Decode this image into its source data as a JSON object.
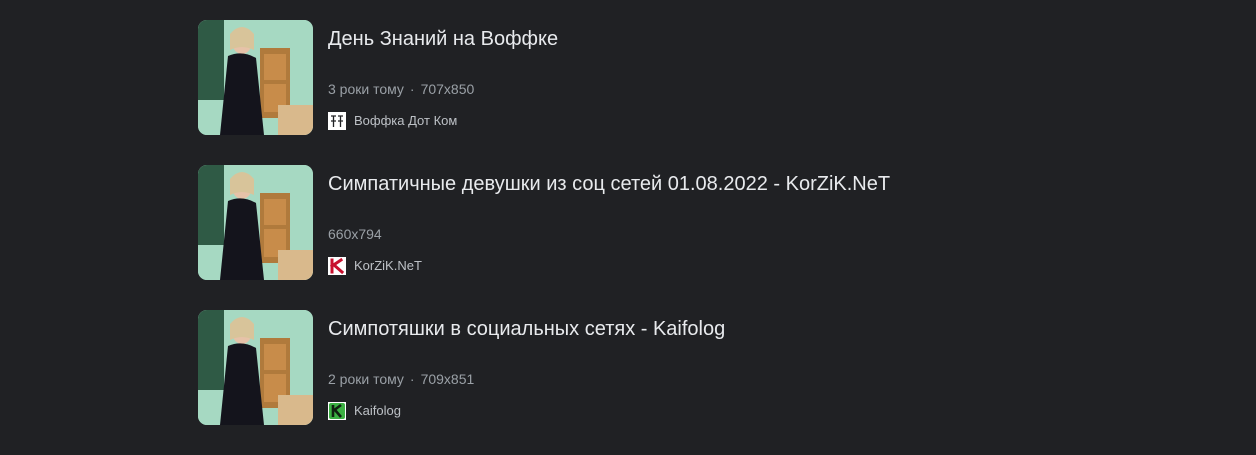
{
  "results": [
    {
      "title": "День Знаний на Воффке",
      "age": "3 роки тому",
      "separator": "·",
      "dimensions": "707x850",
      "source": "Воффка Дот Ком",
      "favicon": "voffka-favicon"
    },
    {
      "title": "Симпатичные девушки из соц сетей 01.08.2022 - KorZiK.NeT",
      "age": "",
      "separator": "",
      "dimensions": "660x794",
      "source": "KorZiK.NeT",
      "favicon": "korzik-favicon"
    },
    {
      "title": "Симпотяшки в социальных сетях - Kaifolog",
      "age": "2 роки тому",
      "separator": "·",
      "dimensions": "709x851",
      "source": "Kaifolog",
      "favicon": "kaifolog-favicon"
    }
  ],
  "colors": {
    "background": "#202124",
    "title": "#e8eaed",
    "meta": "#9aa0a6",
    "source": "#bdc1c6",
    "korzik_accent": "#c8102e",
    "kaifolog_accent": "#3cb043"
  }
}
